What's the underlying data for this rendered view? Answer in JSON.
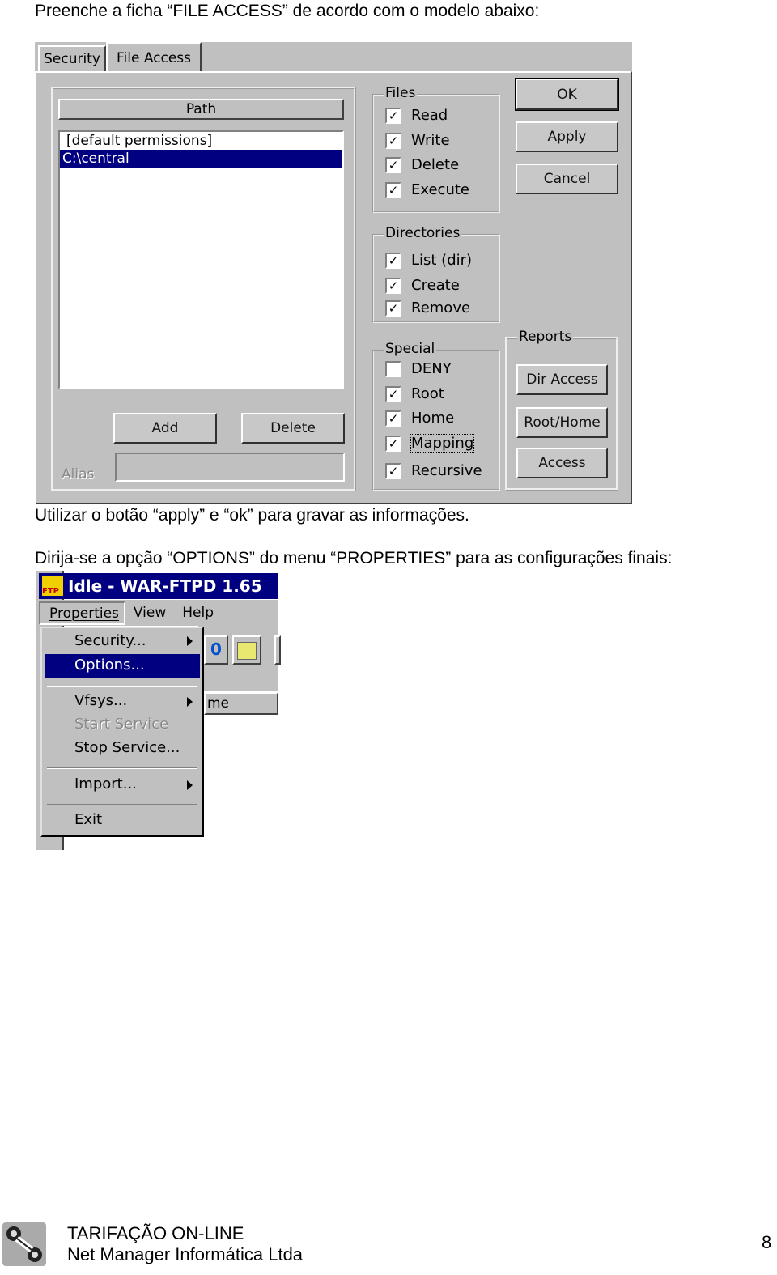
{
  "intro_text": "Preenche a ficha “FILE ACCESS” de acordo com o modelo abaixo:",
  "dialog": {
    "tabs": [
      "Security",
      "File Access"
    ],
    "path_header": "Path",
    "path_list": [
      "[default permissions]",
      "C:\\central"
    ],
    "add_label": "Add",
    "delete_label": "Delete",
    "alias_label": "Alias",
    "alias_value": "",
    "files": {
      "title": "Files",
      "items": [
        {
          "label": "Read",
          "checked": true
        },
        {
          "label": "Write",
          "checked": true
        },
        {
          "label": "Delete",
          "checked": true
        },
        {
          "label": "Execute",
          "checked": true
        }
      ]
    },
    "directories": {
      "title": "Directories",
      "items": [
        {
          "label": "List (dir)",
          "checked": true
        },
        {
          "label": "Create",
          "checked": true
        },
        {
          "label": "Remove",
          "checked": true
        }
      ]
    },
    "special": {
      "title": "Special",
      "items": [
        {
          "label": "DENY",
          "checked": false
        },
        {
          "label": "Root",
          "checked": true
        },
        {
          "label": "Home",
          "checked": true
        },
        {
          "label": "Mapping",
          "checked": true
        },
        {
          "label": "Recursive",
          "checked": true
        }
      ]
    },
    "reports": {
      "title": "Reports",
      "buttons": [
        "Dir Access",
        "Root/Home",
        "Access"
      ]
    },
    "ok_label": "OK",
    "apply_label": "Apply",
    "cancel_label": "Cancel"
  },
  "note_text": "Utilizar o botão “apply” e “ok” para gravar as informações.",
  "menu_intro_text": "Dirija-se a opção “OPTIONS”  do menu “PROPERTIES” para as configurações  finais:",
  "app": {
    "title": "Idle - WAR-FTPD 1.65",
    "menubar": [
      "Properties",
      "View",
      "Help"
    ],
    "menu_items": [
      "Security...",
      "Options...",
      "Vfsys...",
      "Start Service",
      "Stop Service...",
      "Import...",
      "Exit"
    ],
    "toolbar_button": "0",
    "column_fragment": "me"
  },
  "footer": {
    "title": "TARIFAÇÃO ON-LINE",
    "company": "Net Manager Informática Ltda",
    "page_number": "8"
  },
  "colors": {
    "window_bg": "#c0c0c0",
    "selection": "#000080"
  }
}
